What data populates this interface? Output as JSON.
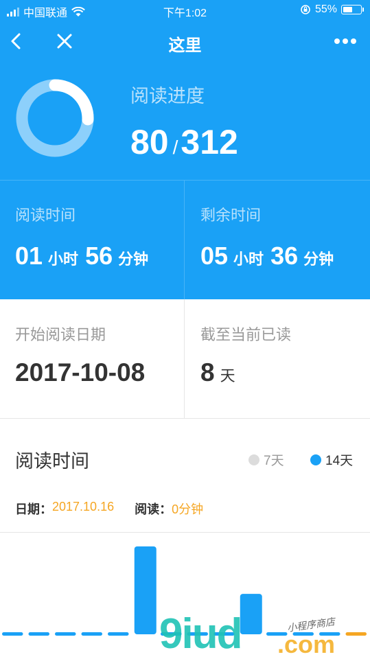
{
  "status_bar": {
    "carrier": "中国联通",
    "time": "下午1:02",
    "battery_percent": "55%",
    "battery_level": 0.55
  },
  "nav": {
    "title": "这里",
    "back_icon": "chevron-left-icon",
    "close_icon": "close-icon",
    "more_icon": "more-dots-icon"
  },
  "progress": {
    "label": "阅读进度",
    "current": "80",
    "separator": "/",
    "total": "312",
    "fraction": 0.2564
  },
  "stats": {
    "reading_time": {
      "label": "阅读时间",
      "hours": "01",
      "hours_unit": "小时",
      "minutes": "56",
      "minutes_unit": "分钟"
    },
    "remaining_time": {
      "label": "剩余时间",
      "hours": "05",
      "hours_unit": "小时",
      "minutes": "36",
      "minutes_unit": "分钟"
    },
    "start_date": {
      "label": "开始阅读日期",
      "value": "2017-10-08"
    },
    "days_read": {
      "label": "截至当前已读",
      "value": "8",
      "unit": "天"
    }
  },
  "chart_section": {
    "title": "阅读时间",
    "legend": [
      {
        "label": "7天",
        "color": "#dcdcdc",
        "selected": false
      },
      {
        "label": "14天",
        "color": "#1aa1f6",
        "selected": true
      }
    ],
    "date_key": "日期：",
    "date_value": "2017.10.16",
    "read_key": "阅读：",
    "read_value": "0分钟"
  },
  "chart_data": {
    "type": "bar",
    "values": [
      0,
      0,
      0,
      0,
      0,
      1,
      0,
      0,
      0,
      0.46,
      0,
      0,
      0,
      0
    ],
    "highlight_index": 13,
    "title": "",
    "xlabel": "",
    "ylabel": ""
  },
  "colors": {
    "primary": "#1aa1f6",
    "accent": "#f5a623",
    "ring_track": "#8dd0fb"
  },
  "watermark": {
    "main": "9iud",
    "suffix": ".com",
    "tag": "小程序商店"
  }
}
